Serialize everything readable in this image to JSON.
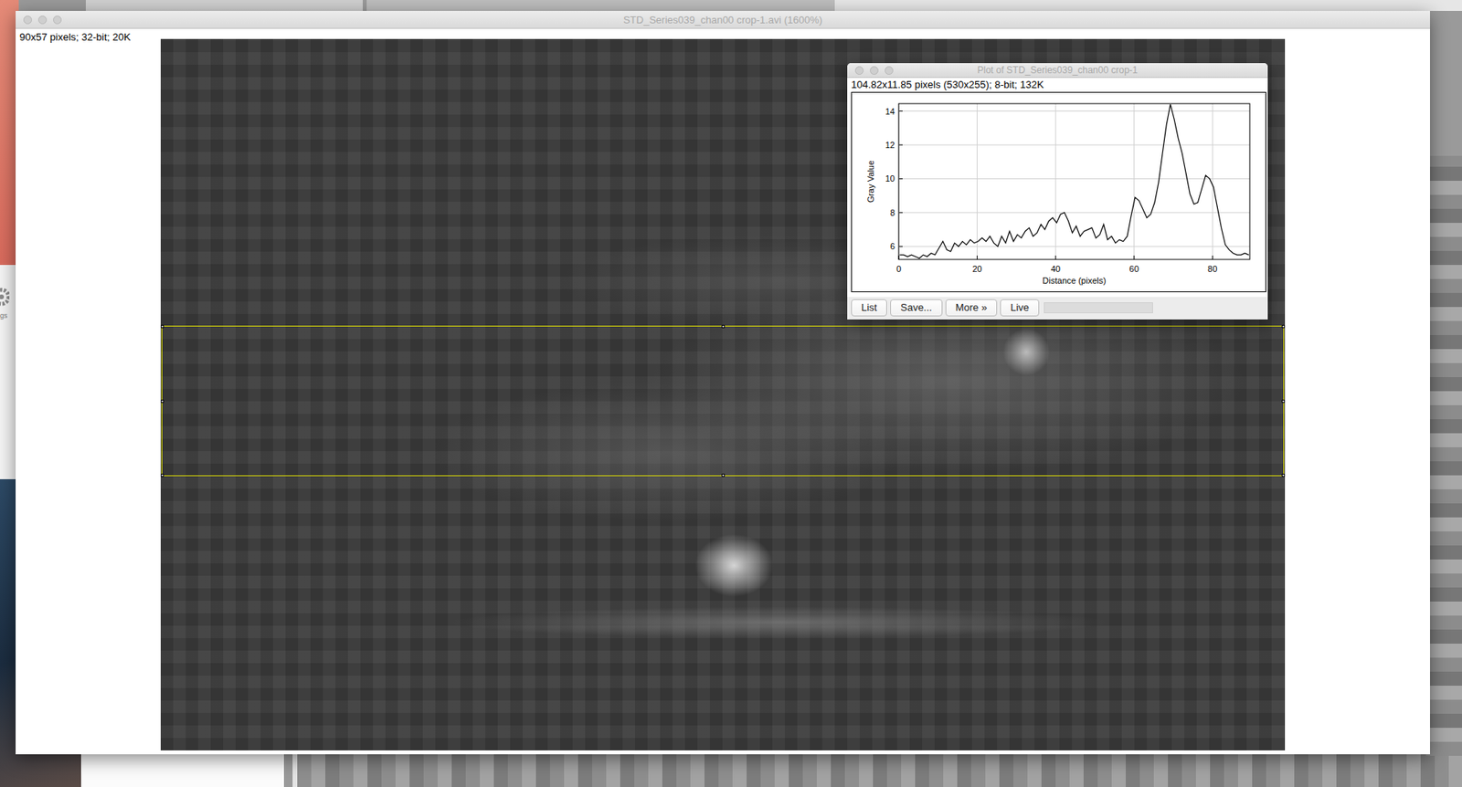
{
  "window": {
    "title": "STD_Series039_chan00 crop-1.avi (1600%)",
    "info": "90x57 pixels; 32-bit; 20K"
  },
  "plot_window": {
    "title": "Plot of STD_Series039_chan00 crop-1",
    "info": "104.82x11.85 pixels (530x255); 8-bit; 132K",
    "chart": {
      "y_label": "Gray Value",
      "x_label": "Distance (pixels)",
      "y_ticks": [
        "6",
        "8",
        "10",
        "12",
        "14"
      ],
      "x_ticks": [
        "0",
        "20",
        "40",
        "60",
        "80"
      ],
      "series": [
        {
          "name": "profile",
          "values": [
            5.5,
            5.5,
            5.4,
            5.5,
            5.4,
            5.3,
            5.5,
            5.4,
            5.6,
            5.5,
            5.9,
            6.3,
            5.8,
            5.7,
            6.2,
            6.0,
            6.3,
            6.1,
            6.4,
            6.2,
            6.3,
            6.5,
            6.3,
            6.6,
            6.2,
            6.0,
            6.6,
            6.2,
            6.9,
            6.3,
            6.7,
            6.5,
            6.9,
            7.1,
            6.6,
            6.8,
            7.3,
            7.0,
            7.5,
            7.7,
            7.4,
            7.9,
            8.0,
            7.5,
            6.8,
            7.2,
            6.6,
            6.9,
            7.0,
            7.1,
            6.5,
            6.7,
            7.3,
            6.4,
            6.6,
            6.2,
            6.4,
            6.3,
            6.6,
            7.8,
            8.9,
            8.7,
            8.2,
            7.7,
            7.9,
            8.6,
            9.8,
            11.5,
            13.2,
            14.4,
            13.5,
            12.4,
            11.5,
            10.3,
            9.1,
            8.5,
            8.6,
            9.4,
            10.2,
            10.0,
            9.5,
            8.3,
            7.1,
            6.1,
            5.8,
            5.6,
            5.5,
            5.5,
            5.6,
            5.5
          ]
        }
      ]
    },
    "buttons": [
      "List",
      "Save...",
      "More »",
      "Live"
    ],
    "progress": {
      "level": 0
    }
  },
  "desktop": {
    "partial_label": "gs"
  }
}
